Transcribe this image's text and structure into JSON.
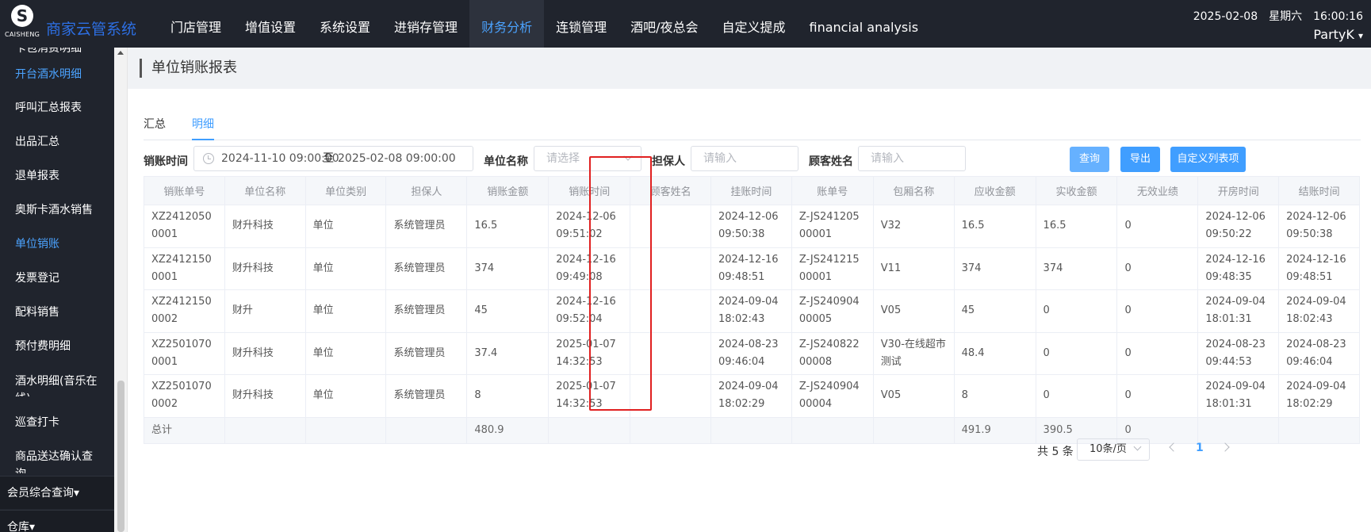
{
  "brand": {
    "logo_text": "CAISHENG",
    "logo_glyph": "S",
    "system_name": "商家云管系统"
  },
  "nav": [
    {
      "label": "门店管理"
    },
    {
      "label": "增值设置"
    },
    {
      "label": "系统设置"
    },
    {
      "label": "进销存管理"
    },
    {
      "label": "财务分析",
      "active": true
    },
    {
      "label": "连锁管理"
    },
    {
      "label": "酒吧/夜总会"
    },
    {
      "label": "自定义提成"
    },
    {
      "label": "financial analysis"
    }
  ],
  "header": {
    "date": "2025-02-08",
    "weekday": "星期六",
    "time": "16:00:16",
    "user": "PartyK",
    "user_caret": "▾"
  },
  "sidebar": {
    "items": [
      {
        "label": "卡包消费明细"
      },
      {
        "label": "开台酒水明细",
        "active": true
      },
      {
        "label": "呼叫汇总报表"
      },
      {
        "label": "出品汇总"
      },
      {
        "label": "退单报表"
      },
      {
        "label": "奥斯卡酒水销售"
      },
      {
        "label": "单位销账",
        "active": true
      },
      {
        "label": "发票登记"
      },
      {
        "label": "配料销售"
      },
      {
        "label": "预付费明细"
      },
      {
        "label": "酒水明细(音乐在线)"
      },
      {
        "label": "巡查打卡"
      },
      {
        "label": "商品送达确认查询"
      }
    ],
    "groups": [
      {
        "label": "会员综合查询▾"
      },
      {
        "label": "仓库▾"
      }
    ]
  },
  "page": {
    "title": "单位销账报表"
  },
  "tabs": [
    {
      "label": "汇总"
    },
    {
      "label": "明细",
      "active": true
    }
  ],
  "filters": {
    "time_label": "销账时间",
    "start": "2024-11-10 09:00:00",
    "range_sep": "至",
    "end": "2025-02-08 09:00:00",
    "unit_label": "单位名称",
    "unit_placeholder": "请选择",
    "guarantor_label": "担保人",
    "guarantor_placeholder": "请输入",
    "customer_label": "顾客姓名",
    "customer_placeholder": "请输入"
  },
  "buttons": {
    "query": "查询",
    "export": "导出",
    "custom_columns": "自定义列表项"
  },
  "table": {
    "columns": [
      "销账单号",
      "单位名称",
      "单位类别",
      "担保人",
      "销账金额",
      "销账时间",
      "顾客姓名",
      "挂账时间",
      "账单号",
      "包厢名称",
      "应收金额",
      "实收金额",
      "无效业绩",
      "开房时间",
      "结账时间"
    ],
    "rows": [
      [
        "XZ24120500001",
        "财升科技",
        "单位",
        "系统管理员",
        "16.5",
        "2024-12-06 09:51:02",
        "",
        "2024-12-06 09:50:38",
        "Z-JS24120500001",
        "V32",
        "16.5",
        "16.5",
        "0",
        "2024-12-06 09:50:22",
        "2024-12-06 09:50:38"
      ],
      [
        "XZ24121500001",
        "财升科技",
        "单位",
        "系统管理员",
        "374",
        "2024-12-16 09:49:08",
        "",
        "2024-12-16 09:48:51",
        "Z-JS24121500001",
        "V11",
        "374",
        "374",
        "0",
        "2024-12-16 09:48:35",
        "2024-12-16 09:48:51"
      ],
      [
        "XZ24121500002",
        "财升",
        "单位",
        "系统管理员",
        "45",
        "2024-12-16 09:52:04",
        "",
        "2024-09-04 18:02:43",
        "Z-JS24090400005",
        "V05",
        "45",
        "0",
        "0",
        "2024-09-04 18:01:31",
        "2024-09-04 18:02:43"
      ],
      [
        "XZ25010700001",
        "财升科技",
        "单位",
        "系统管理员",
        "37.4",
        "2025-01-07 14:32:53",
        "",
        "2024-08-23 09:46:04",
        "Z-JS24082200008",
        "V30-在线超市测试",
        "48.4",
        "0",
        "0",
        "2024-08-23 09:44:53",
        "2024-08-23 09:46:04"
      ],
      [
        "XZ25010700002",
        "财升科技",
        "单位",
        "系统管理员",
        "8",
        "2025-01-07 14:32:53",
        "",
        "2024-09-04 18:02:29",
        "Z-JS24090400004",
        "V05",
        "8",
        "0",
        "0",
        "2024-09-04 18:01:31",
        "2024-09-04 18:02:29"
      ]
    ],
    "summary": [
      "总计",
      "",
      "",
      "",
      "480.9",
      "",
      "",
      "",
      "",
      "",
      "491.9",
      "390.5",
      "0",
      "",
      ""
    ]
  },
  "pagination": {
    "total": "共 5 条",
    "page_size": "10条/页",
    "current": "1"
  },
  "colors": {
    "topbar": "#20242d",
    "accent": "#409eff",
    "highlight": "#e02020"
  }
}
